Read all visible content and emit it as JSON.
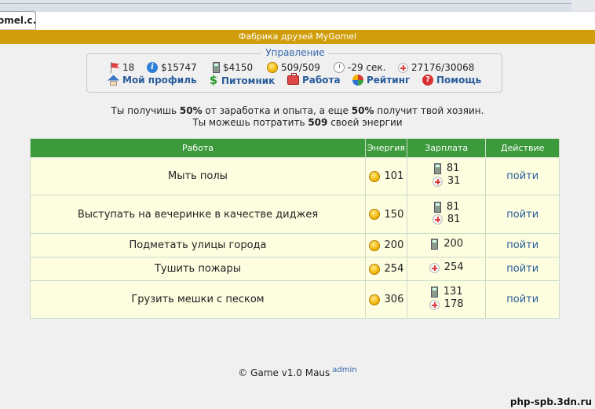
{
  "browser": {
    "tab_label": "omel.c..."
  },
  "header": {
    "title": "Фабрика друзей MyGomel"
  },
  "control": {
    "legend": "Управление",
    "stats": [
      {
        "icon": "flag-icon",
        "value": "18"
      },
      {
        "icon": "info-icon",
        "value": "$15747"
      },
      {
        "icon": "calculator-icon",
        "value": "$4150"
      },
      {
        "icon": "energy-coin-icon",
        "value": "509/509"
      },
      {
        "icon": "clock-icon",
        "value": "-29 сек."
      },
      {
        "icon": "health-icon",
        "value": "27176/30068"
      }
    ],
    "nav": [
      {
        "icon": "home-icon",
        "label": "Мой профиль"
      },
      {
        "icon": "dollar-icon",
        "label": "Питомник"
      },
      {
        "icon": "briefcase-icon",
        "label": "Работа"
      },
      {
        "icon": "globe-icon",
        "label": "Рейтинг"
      },
      {
        "icon": "help-icon",
        "label": "Помощь"
      }
    ]
  },
  "info": {
    "line1_a": "Ты получишь ",
    "line1_pct1": "50%",
    "line1_b": " от заработка и опыта, а еще ",
    "line1_pct2": "50%",
    "line1_c": " получит твой хозяин.",
    "line2_a": "Ты можешь потратить ",
    "line2_val": "509",
    "line2_b": " своей энергии"
  },
  "table": {
    "headers": [
      "Работа",
      "Энергия",
      "Зарплата",
      "Действие"
    ],
    "rows": [
      {
        "job": "Мыть полы",
        "energy": "101",
        "salary_money": "81",
        "salary_health": "31",
        "action": "пойти"
      },
      {
        "job": "Выступать на вечеринке в качестве диджея",
        "energy": "150",
        "salary_money": "81",
        "salary_health": "81",
        "action": "пойти"
      },
      {
        "job": "Подметать улицы города",
        "energy": "200",
        "salary_money": "200",
        "salary_health": "",
        "action": "пойти"
      },
      {
        "job": "Тушить пожары",
        "energy": "254",
        "salary_money": "",
        "salary_health": "254",
        "action": "пойти"
      },
      {
        "job": "Грузить мешки с песком",
        "energy": "306",
        "salary_money": "131",
        "salary_health": "178",
        "action": "пойти"
      }
    ]
  },
  "footer": {
    "text": "© Game v1.0 Maus",
    "admin": "admin"
  },
  "watermark": "php-spb.3dn.ru",
  "colors": {
    "header_band": "#d19e0b",
    "table_header": "#3c9a3c",
    "row_bg": "#fdfde0",
    "link": "#2a5c9a"
  }
}
